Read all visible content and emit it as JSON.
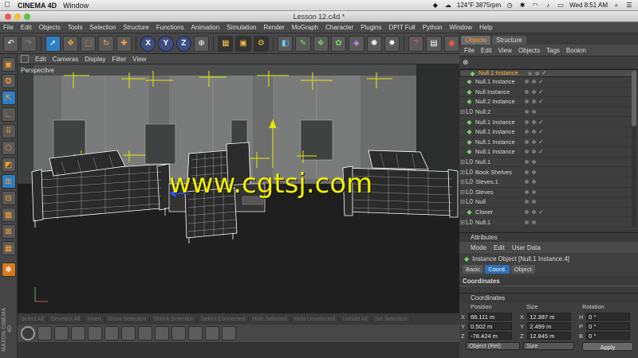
{
  "macbar": {
    "app_name": "CINEMA 4D",
    "menu": "Window",
    "temp": "124°F 3875rpm",
    "clock": "Wed 8:51 AM"
  },
  "window": {
    "title": "Lesson 12.c4d *"
  },
  "app_menu": [
    "File",
    "Edit",
    "Objects",
    "Tools",
    "Selection",
    "Structure",
    "Functions",
    "Animation",
    "Simulation",
    "Render",
    "MoGraph",
    "Character",
    "Plugins",
    "DPIT Full",
    "Python",
    "Window",
    "Help"
  ],
  "viewport": {
    "menu": [
      "Edit",
      "Cameras",
      "Display",
      "Filter",
      "View"
    ],
    "label": "Perspective",
    "watermark": "www.cgtsj.com"
  },
  "timeline": {
    "buttons": [
      "Select All",
      "Deselect All",
      "Invert",
      "Grow Selection",
      "Shrink Selection",
      "Select Connected",
      "Hide Selected",
      "Hide Unselected",
      "Unhide All",
      "Set Selection"
    ]
  },
  "objects_panel": {
    "tabs": [
      "Objects",
      "Structure"
    ],
    "menu": [
      "File",
      "Edit",
      "View",
      "Objects",
      "Tags",
      "Bookm"
    ],
    "items": [
      {
        "name": "Null.1 Instance",
        "type": "inst",
        "selected": true,
        "check": true,
        "tree": "-"
      },
      {
        "name": "Null.1 Instance",
        "type": "inst",
        "selected": false,
        "check": true,
        "tree": "-"
      },
      {
        "name": "Null Instance",
        "type": "inst",
        "selected": false,
        "check": true,
        "tree": "-"
      },
      {
        "name": "Null.2 Instance",
        "type": "inst",
        "selected": false,
        "check": true,
        "tree": "-"
      },
      {
        "name": "Null.2",
        "type": "null",
        "selected": false,
        "check": false,
        "tree": "+"
      },
      {
        "name": "Null.1 Instance",
        "type": "inst",
        "selected": false,
        "check": true,
        "tree": "-"
      },
      {
        "name": "Null.1 Instance",
        "type": "inst",
        "selected": false,
        "check": true,
        "tree": "-"
      },
      {
        "name": "Null.1 Instance",
        "type": "inst",
        "selected": false,
        "check": true,
        "tree": "-"
      },
      {
        "name": "Null.1 Instance",
        "type": "inst",
        "selected": false,
        "check": true,
        "tree": "-"
      },
      {
        "name": "Null.1",
        "type": "null",
        "selected": false,
        "check": false,
        "tree": "+"
      },
      {
        "name": "Book Shelves",
        "type": "null",
        "selected": false,
        "check": false,
        "tree": "+"
      },
      {
        "name": "Sleves.1",
        "type": "null",
        "selected": false,
        "check": false,
        "tree": "+"
      },
      {
        "name": "Sleves",
        "type": "null",
        "selected": false,
        "check": false,
        "tree": "+"
      },
      {
        "name": "Null",
        "type": "null",
        "selected": false,
        "check": false,
        "tree": "+"
      },
      {
        "name": "Cloner",
        "type": "inst",
        "selected": false,
        "check": true,
        "tree": "-"
      },
      {
        "name": "Null.1",
        "type": "null",
        "selected": false,
        "check": false,
        "tree": "+"
      }
    ]
  },
  "attributes": {
    "header": "Attributes",
    "menu": [
      "Mode",
      "Edit",
      "User Data"
    ],
    "title": "Instance Object [Null.1 Instance.4]",
    "tabs": [
      "Basic",
      "Coord.",
      "Object"
    ],
    "section": "Coordinates"
  },
  "coordinates": {
    "title": "Coordinates",
    "columns": [
      "Position",
      "Size",
      "Rotation"
    ],
    "rows": [
      {
        "axis": "X",
        "pos": "66.111 m",
        "size_axis": "X",
        "size": "12.387 m",
        "rot_axis": "H",
        "rot": "0 °"
      },
      {
        "axis": "Y",
        "pos": "0.502 m",
        "size_axis": "Y",
        "size": "2.499 m",
        "rot_axis": "P",
        "rot": "0 °"
      },
      {
        "axis": "Z",
        "pos": "-78.424 m",
        "size_axis": "Z",
        "size": "12.845 m",
        "rot_axis": "B",
        "rot": "0 °"
      }
    ],
    "mode_select": "Object (Rel)",
    "size_select": "Size",
    "apply_label": "Apply"
  },
  "left_brand": "MAXON CINEMA 4D"
}
